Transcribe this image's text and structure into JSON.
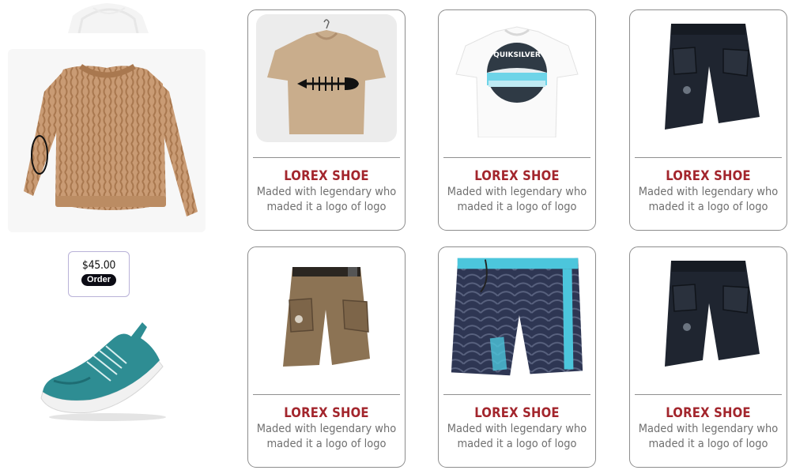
{
  "featured": {
    "price": "$45.00",
    "order_label": "Order"
  },
  "products": [
    {
      "title": "LOREX SHOE",
      "description": "Maded with legendary who maded it a logo of logo",
      "image": "fishbone-tshirt-image"
    },
    {
      "title": "LOREX SHOE",
      "description": "Maded with legendary who maded it a logo of logo",
      "image": "quiksilver-tshirt-image"
    },
    {
      "title": "LOREX SHOE",
      "description": "Maded with legendary who maded it a logo of logo",
      "image": "black-cargo-shorts-image"
    },
    {
      "title": "LOREX SHOE",
      "description": "Maded with legendary who maded it a logo of logo",
      "image": "khaki-cargo-shorts-image"
    },
    {
      "title": "LOREX SHOE",
      "description": "Maded with legendary who maded it a logo of logo",
      "image": "tribal-boardshorts-image"
    },
    {
      "title": "LOREX SHOE",
      "description": "Maded with legendary who maded it a logo of logo",
      "image": "black-cargo-shorts-image"
    }
  ],
  "colors": {
    "title_red": "#a3262d",
    "desc_gray": "#707070",
    "card_border": "#8d8d8d"
  }
}
